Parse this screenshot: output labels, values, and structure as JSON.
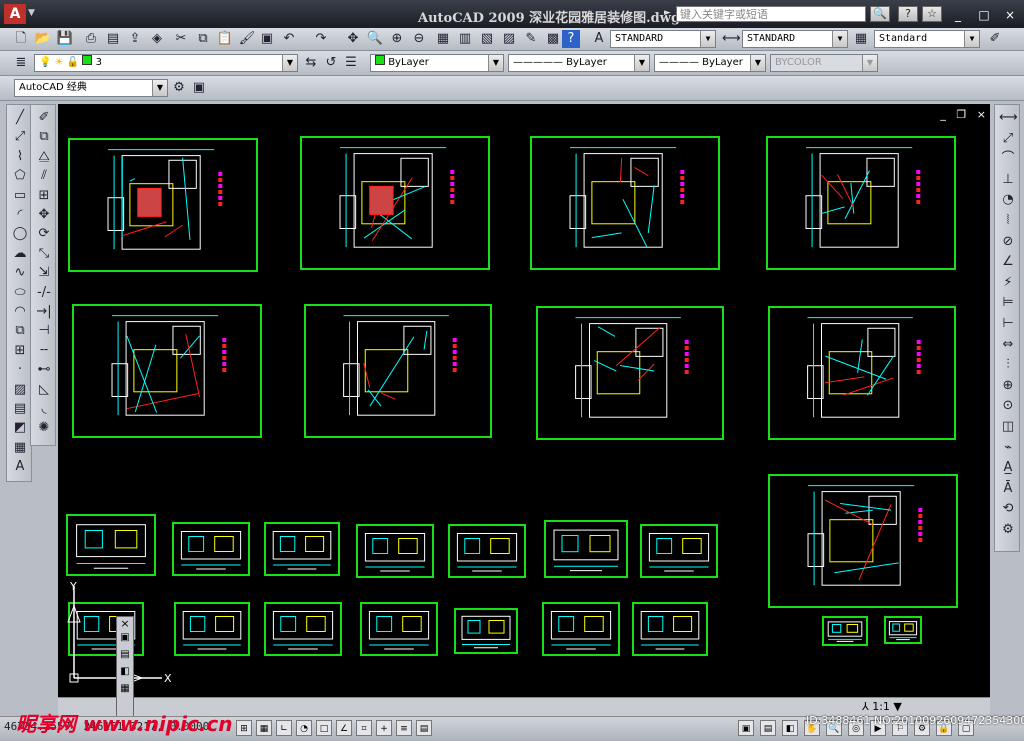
{
  "window": {
    "title": "AutoCAD  2009  深业花园雅居装修图.dwg",
    "app_logo": "A",
    "search_placeholder": "键入关键字或短语",
    "search_icon": "binoculars-icon",
    "help_icon": "help-icon",
    "star_icon": "star-icon",
    "minimize": "_",
    "restore": "□",
    "close": "×"
  },
  "toolbar": {
    "text_style": "STANDARD",
    "dim_style": "STANDARD",
    "table_style": "Standard",
    "layer_value": "3",
    "color_value": "ByLayer",
    "linetype_value": "————— ByLayer",
    "lineweight_value": "———— ByLayer",
    "plotstyle_value": "BYCOLOR",
    "workspace": "AutoCAD 经典"
  },
  "drawing_window": {
    "minimize": "_",
    "restore": "❐",
    "close": "×"
  },
  "status": {
    "coords": "46734.1557,  246151.3217,  0.0000",
    "scale": "1:1"
  },
  "watermark": {
    "brand": "昵享网 www.nipic.cn",
    "id": "ID:3488461 NO:20100926094723543000"
  },
  "colors": {
    "sheet_border": "#17e017",
    "canvas_bg": "#000000",
    "wall_white": "#ffffff",
    "accent_yellow": "#ffff00",
    "accent_red": "#ff2020",
    "accent_cyan": "#00ffff",
    "accent_magenta": "#ff00ff"
  },
  "icons": {
    "left_draw_toolbar": [
      "line-icon",
      "construction-line-icon",
      "polyline-icon",
      "polygon-icon",
      "rectangle-icon",
      "arc-icon",
      "circle-icon",
      "revision-cloud-icon",
      "spline-icon",
      "ellipse-icon",
      "ellipse-arc-icon",
      "insert-block-icon",
      "make-block-icon",
      "point-icon",
      "hatch-icon",
      "gradient-icon",
      "region-icon",
      "table-icon",
      "text-icon"
    ],
    "left_modify_toolbar": [
      "erase-icon",
      "copy-icon",
      "mirror-icon",
      "offset-icon",
      "array-icon",
      "move-icon",
      "rotate-icon",
      "scale-icon",
      "stretch-icon",
      "trim-icon",
      "extend-icon",
      "break-at-point-icon",
      "break-icon",
      "join-icon",
      "chamfer-icon",
      "fillet-icon",
      "explode-icon"
    ],
    "right_dim_toolbar": [
      "linear-dim-icon",
      "aligned-dim-icon",
      "arc-length-icon",
      "ordinate-icon",
      "radius-icon",
      "jogged-icon",
      "diameter-icon",
      "angular-icon",
      "quick-dim-icon",
      "baseline-icon",
      "continue-icon",
      "dim-space-icon",
      "dim-break-icon",
      "tolerance-icon",
      "center-mark-icon",
      "inspection-icon",
      "jogged-linear-icon",
      "dim-edit-icon",
      "dim-text-edit-icon",
      "dim-update-icon",
      "dim-style-icon"
    ]
  }
}
